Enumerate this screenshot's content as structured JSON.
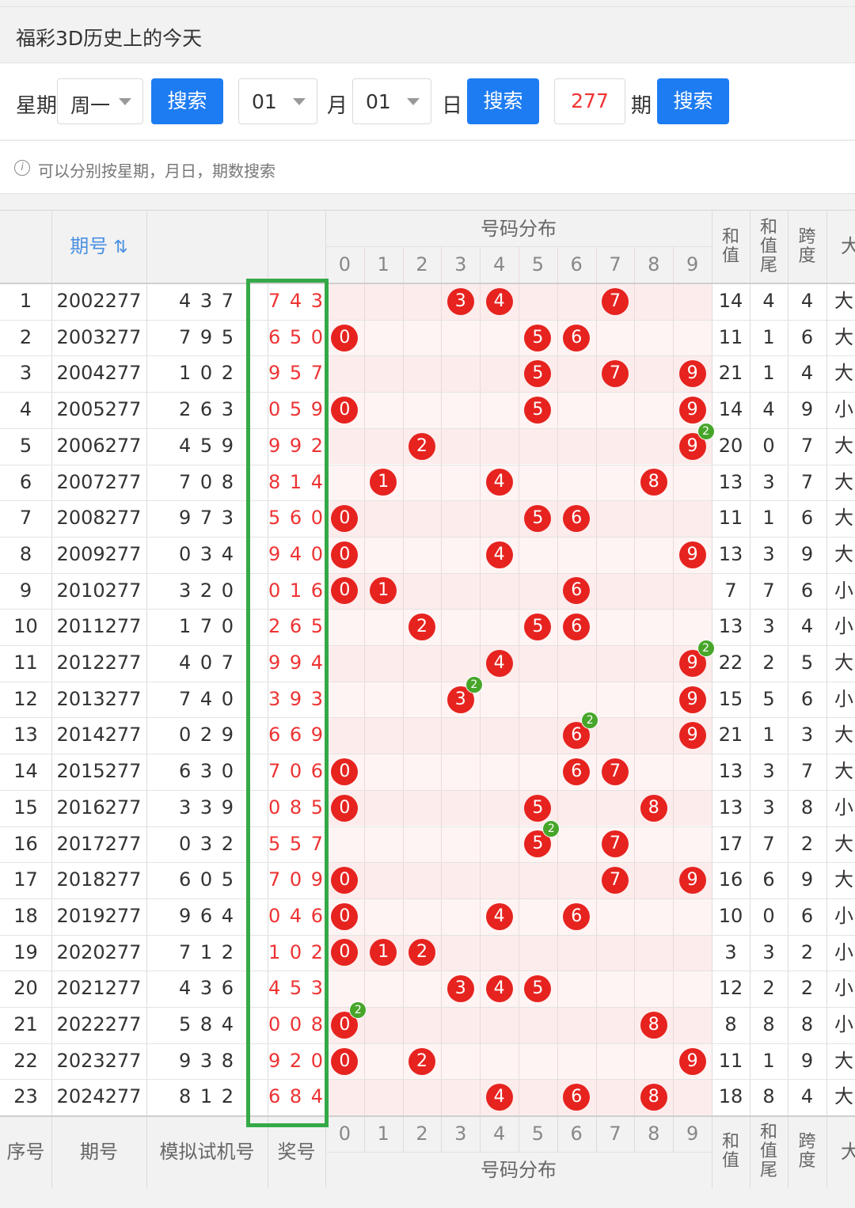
{
  "title": "福彩3D历史上的今天",
  "search": {
    "weekday_label": "星期",
    "weekday_value": "周一",
    "month_value": "01",
    "month_label": "月",
    "day_value": "01",
    "day_label": "日",
    "issue_value": "277",
    "issue_label": "期",
    "search_label": "搜索"
  },
  "tip": "可以分别按星期，月日，期数搜索",
  "table": {
    "headers": {
      "seq": "序号",
      "issue": "期号",
      "sort_icon": "⇅",
      "trial": "模拟试机号",
      "prize": "奖号",
      "distribution": "号码分布",
      "sum": "和值",
      "sum_tail": "和值尾",
      "span": "跨度",
      "size": "大"
    },
    "digits": [
      "0",
      "1",
      "2",
      "3",
      "4",
      "5",
      "6",
      "7",
      "8",
      "9"
    ],
    "rows": [
      {
        "seq": "1",
        "issue": "2002277",
        "trial": "4 3 7",
        "prize": "7 4 3",
        "sum": "14",
        "tail": "4",
        "span": "4",
        "size": "大",
        "balls": [
          3,
          4,
          7
        ],
        "dup": null
      },
      {
        "seq": "2",
        "issue": "2003277",
        "trial": "7 9 5",
        "prize": "6 5 0",
        "sum": "11",
        "tail": "1",
        "span": "6",
        "size": "大",
        "balls": [
          0,
          5,
          6
        ],
        "dup": null
      },
      {
        "seq": "3",
        "issue": "2004277",
        "trial": "1 0 2",
        "prize": "9 5 7",
        "sum": "21",
        "tail": "1",
        "span": "4",
        "size": "大",
        "balls": [
          5,
          7,
          9
        ],
        "dup": null
      },
      {
        "seq": "4",
        "issue": "2005277",
        "trial": "2 6 3",
        "prize": "0 5 9",
        "sum": "14",
        "tail": "4",
        "span": "9",
        "size": "小",
        "balls": [
          0,
          5,
          9
        ],
        "dup": null
      },
      {
        "seq": "5",
        "issue": "2006277",
        "trial": "4 5 9",
        "prize": "9 9 2",
        "sum": "20",
        "tail": "0",
        "span": "7",
        "size": "大",
        "balls": [
          2,
          9
        ],
        "dup": 9
      },
      {
        "seq": "6",
        "issue": "2007277",
        "trial": "7 0 8",
        "prize": "8 1 4",
        "sum": "13",
        "tail": "3",
        "span": "7",
        "size": "大",
        "balls": [
          1,
          4,
          8
        ],
        "dup": null
      },
      {
        "seq": "7",
        "issue": "2008277",
        "trial": "9 7 3",
        "prize": "5 6 0",
        "sum": "11",
        "tail": "1",
        "span": "6",
        "size": "大",
        "balls": [
          0,
          5,
          6
        ],
        "dup": null
      },
      {
        "seq": "8",
        "issue": "2009277",
        "trial": "0 3 4",
        "prize": "9 4 0",
        "sum": "13",
        "tail": "3",
        "span": "9",
        "size": "大",
        "balls": [
          0,
          4,
          9
        ],
        "dup": null
      },
      {
        "seq": "9",
        "issue": "2010277",
        "trial": "3 2 0",
        "prize": "0 1 6",
        "sum": "7",
        "tail": "7",
        "span": "6",
        "size": "小",
        "balls": [
          0,
          1,
          6
        ],
        "dup": null
      },
      {
        "seq": "10",
        "issue": "2011277",
        "trial": "1 7 0",
        "prize": "2 6 5",
        "sum": "13",
        "tail": "3",
        "span": "4",
        "size": "小",
        "balls": [
          2,
          5,
          6
        ],
        "dup": null
      },
      {
        "seq": "11",
        "issue": "2012277",
        "trial": "4 0 7",
        "prize": "9 9 4",
        "sum": "22",
        "tail": "2",
        "span": "5",
        "size": "大",
        "balls": [
          4,
          9
        ],
        "dup": 9
      },
      {
        "seq": "12",
        "issue": "2013277",
        "trial": "7 4 0",
        "prize": "3 9 3",
        "sum": "15",
        "tail": "5",
        "span": "6",
        "size": "小",
        "balls": [
          3,
          9
        ],
        "dup": 3
      },
      {
        "seq": "13",
        "issue": "2014277",
        "trial": "0 2 9",
        "prize": "6 6 9",
        "sum": "21",
        "tail": "1",
        "span": "3",
        "size": "大",
        "balls": [
          6,
          9
        ],
        "dup": 6
      },
      {
        "seq": "14",
        "issue": "2015277",
        "trial": "6 3 0",
        "prize": "7 0 6",
        "sum": "13",
        "tail": "3",
        "span": "7",
        "size": "大",
        "balls": [
          0,
          6,
          7
        ],
        "dup": null
      },
      {
        "seq": "15",
        "issue": "2016277",
        "trial": "3 3 9",
        "prize": "0 8 5",
        "sum": "13",
        "tail": "3",
        "span": "8",
        "size": "小",
        "balls": [
          0,
          5,
          8
        ],
        "dup": null
      },
      {
        "seq": "16",
        "issue": "2017277",
        "trial": "0 3 2",
        "prize": "5 5 7",
        "sum": "17",
        "tail": "7",
        "span": "2",
        "size": "大",
        "balls": [
          5,
          7
        ],
        "dup": 5
      },
      {
        "seq": "17",
        "issue": "2018277",
        "trial": "6 0 5",
        "prize": "7 0 9",
        "sum": "16",
        "tail": "6",
        "span": "9",
        "size": "大",
        "balls": [
          0,
          7,
          9
        ],
        "dup": null
      },
      {
        "seq": "18",
        "issue": "2019277",
        "trial": "9 6 4",
        "prize": "0 4 6",
        "sum": "10",
        "tail": "0",
        "span": "6",
        "size": "小",
        "balls": [
          0,
          4,
          6
        ],
        "dup": null
      },
      {
        "seq": "19",
        "issue": "2020277",
        "trial": "7 1 2",
        "prize": "1 0 2",
        "sum": "3",
        "tail": "3",
        "span": "2",
        "size": "小",
        "balls": [
          0,
          1,
          2
        ],
        "dup": null
      },
      {
        "seq": "20",
        "issue": "2021277",
        "trial": "4 3 6",
        "prize": "4 5 3",
        "sum": "12",
        "tail": "2",
        "span": "2",
        "size": "小",
        "balls": [
          3,
          4,
          5
        ],
        "dup": null
      },
      {
        "seq": "21",
        "issue": "2022277",
        "trial": "5 8 4",
        "prize": "0 0 8",
        "sum": "8",
        "tail": "8",
        "span": "8",
        "size": "小",
        "balls": [
          0,
          8
        ],
        "dup": 0
      },
      {
        "seq": "22",
        "issue": "2023277",
        "trial": "9 3 8",
        "prize": "9 2 0",
        "sum": "11",
        "tail": "1",
        "span": "9",
        "size": "大",
        "balls": [
          0,
          2,
          9
        ],
        "dup": null
      },
      {
        "seq": "23",
        "issue": "2024277",
        "trial": "8 1 2",
        "prize": "6 8 4",
        "sum": "18",
        "tail": "8",
        "span": "4",
        "size": "大",
        "balls": [
          4,
          6,
          8
        ],
        "dup": null
      }
    ],
    "dup_count": "2"
  },
  "colors": {
    "accent": "#1e7cf2",
    "ball": "#e6231f",
    "badge": "#47a62a",
    "highlight": "#34a948",
    "prize_text": "#e33"
  }
}
